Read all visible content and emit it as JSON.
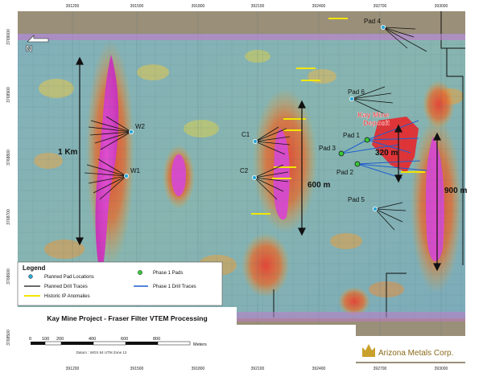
{
  "map": {
    "north_label": "N",
    "grid_x": [
      "391200",
      "391500",
      "391800",
      "392100",
      "392400",
      "392700",
      "393000"
    ],
    "grid_x_bottom": [
      "391200",
      "391500",
      "391800",
      "392100",
      "392400",
      "392700",
      "393000"
    ],
    "grid_y": [
      "3769000",
      "3768900",
      "3768800",
      "3768700",
      "3768600",
      "3768500",
      "3768400"
    ]
  },
  "annotations": {
    "one_km": "1 Km",
    "six_hundred_m": "600 m",
    "three_twenty_m": "320 m",
    "nine_hundred_m": "900 m",
    "deposit_line1": "Kay Mine",
    "deposit_line2": "Deposit"
  },
  "pads": {
    "pad1": "Pad 1",
    "pad2": "Pad 2",
    "pad3": "Pad 3",
    "pad4": "Pad 4",
    "pad5": "Pad 5",
    "pad6": "Pad 6",
    "w1": "W1",
    "w2": "W2",
    "c1": "C1",
    "c2": "C2"
  },
  "legend": {
    "title": "Legend",
    "items": [
      "Planned Pad Locations",
      "Planned Drill Traces",
      "Historic IP Anomalies",
      "Phase 1 Pads",
      "Phase 1 Drill Traces"
    ]
  },
  "title": "Kay Mine Project - Fraser Filter VTEM Processing",
  "scale": {
    "ticks": [
      "0",
      "100",
      "200",
      "400",
      "600",
      "800"
    ],
    "unit": "Meters",
    "datum": "Datum : WGS 84 UTM Zone 12"
  },
  "logo": {
    "company": "Arizona Metals Corp."
  },
  "colors": {
    "pad_cyan": "#2aa8d8",
    "phase1_green": "#38c838",
    "drill_blue": "#1f5fd0",
    "ip_yellow": "#f2e600",
    "anomaly_magenta": "#d838c8",
    "deposit_red": "#e8262a"
  }
}
